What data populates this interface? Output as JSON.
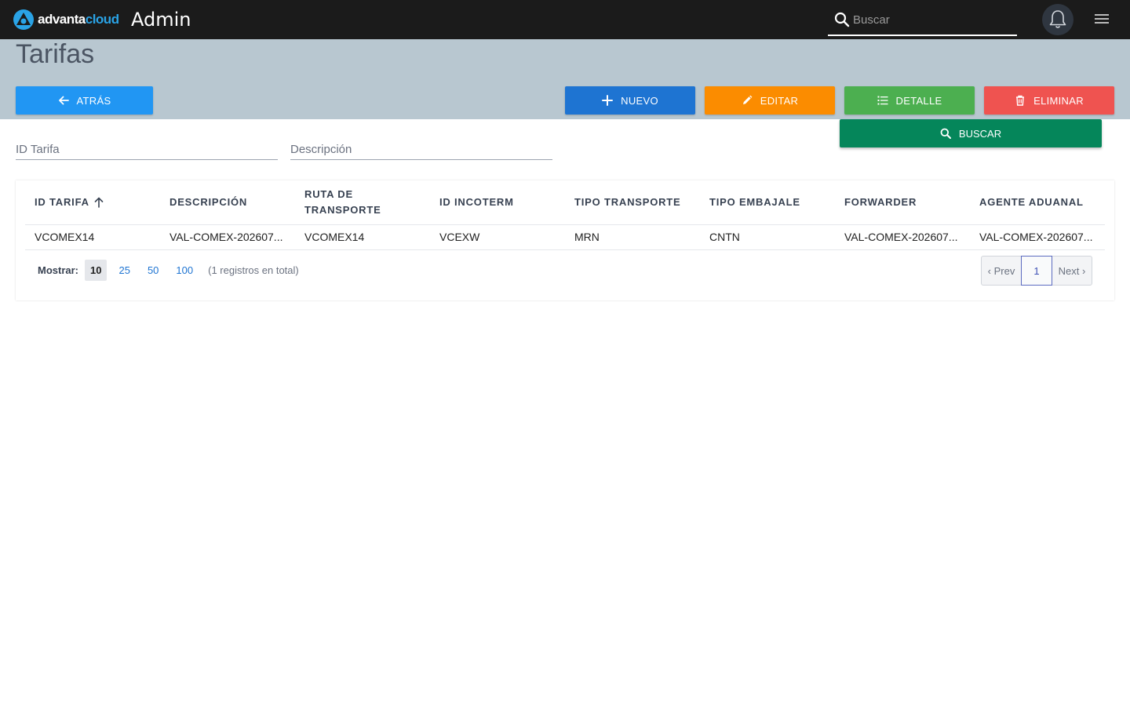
{
  "app": {
    "logo_part1": "advanta",
    "logo_part2": "cloud",
    "title": "Admin",
    "search_placeholder": "Buscar",
    "brand_color": "#2aa3e6"
  },
  "page": {
    "title": "Tarifas"
  },
  "toolbar": {
    "back": "ATRÁS",
    "new": "NUEVO",
    "edit": "EDITAR",
    "detail": "DETALLE",
    "delete": "ELIMINAR",
    "search": "BUSCAR"
  },
  "filters": {
    "id_placeholder": "ID Tarifa",
    "description_placeholder": "Descripción"
  },
  "table": {
    "columns": [
      "ID TARIFA",
      "DESCRIPCIÓN",
      "RUTA DE TRANSPORTE",
      "ID INCOTERM",
      "TIPO TRANSPORTE",
      "TIPO EMBAJALE",
      "FORWARDER",
      "AGENTE ADUANAL"
    ],
    "sorted_column": "ID TARIFA",
    "sort_direction": "ascending",
    "rows": [
      [
        "VCOMEX14",
        "VAL-COMEX-202607...",
        "VCOMEX14",
        "VCEXW",
        "MRN",
        "CNTN",
        "VAL-COMEX-202607...",
        "VAL-COMEX-202607..."
      ]
    ]
  },
  "pagination": {
    "show_label": "Mostrar:",
    "page_sizes": [
      "10",
      "25",
      "50",
      "100"
    ],
    "selected_page_size": "10",
    "total_text": "(1 registros en total)",
    "prev": "‹ Prev",
    "current_page": "1",
    "next": "Next ›"
  }
}
